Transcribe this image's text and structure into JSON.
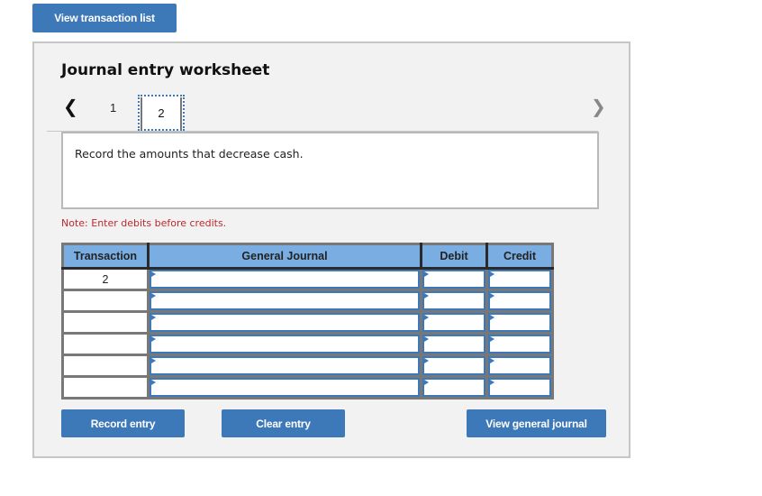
{
  "top_button": {
    "label": "View transaction list"
  },
  "worksheet": {
    "title": "Journal entry worksheet",
    "nav": {
      "prev_icon": "‹",
      "next_icon": "›",
      "tabs": [
        {
          "label": "1",
          "active": false
        },
        {
          "label": "2",
          "active": true
        }
      ]
    },
    "instruction": "Record the amounts that decrease cash.",
    "note": "Note: Enter debits before credits.",
    "table": {
      "headers": [
        "Transaction",
        "General Journal",
        "Debit",
        "Credit"
      ],
      "rows": [
        {
          "transaction": "2",
          "account": "",
          "debit": "",
          "credit": ""
        },
        {
          "transaction": "",
          "account": "",
          "debit": "",
          "credit": ""
        },
        {
          "transaction": "",
          "account": "",
          "debit": "",
          "credit": ""
        },
        {
          "transaction": "",
          "account": "",
          "debit": "",
          "credit": ""
        },
        {
          "transaction": "",
          "account": "",
          "debit": "",
          "credit": ""
        },
        {
          "transaction": "",
          "account": "",
          "debit": "",
          "credit": ""
        }
      ]
    },
    "buttons": {
      "record": "Record entry",
      "clear": "Clear entry",
      "view_journal": "View general journal"
    }
  },
  "colors": {
    "button": "#3d78b8",
    "header": "#7aaee2",
    "note": "#c0272d",
    "panel": "#f2f2f2"
  }
}
